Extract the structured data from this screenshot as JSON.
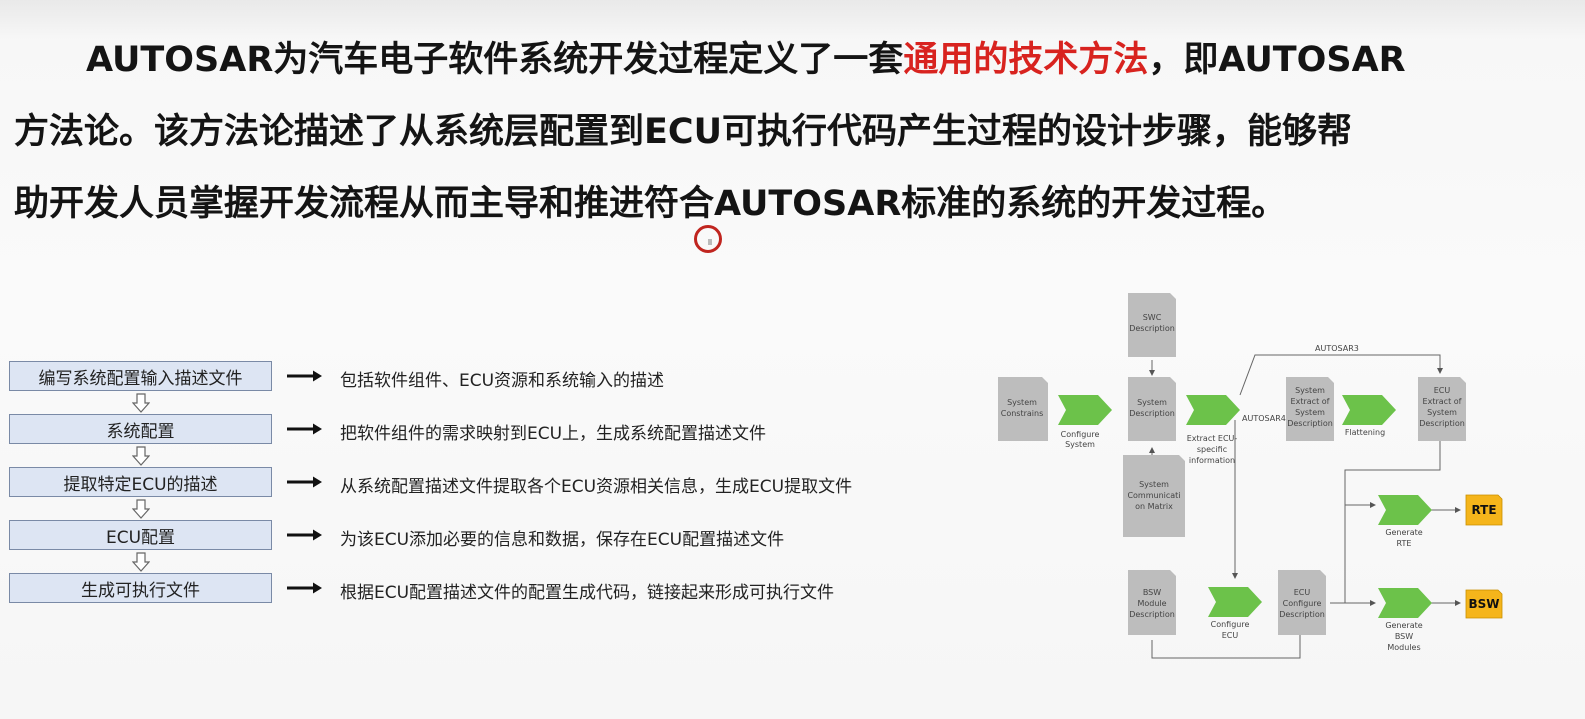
{
  "paragraph": {
    "line1_pre": "AUTOSAR为汽车电子软件系统开发过程定义了一套",
    "line1_highlight": "通用的技术方法",
    "line1_post": "，即AUTOSAR",
    "line2": "方法论。该方法论描述了从系统层配置到ECU可执行代码产生过程的设计步骤，能够帮",
    "line3": "助开发人员掌握开发流程从而主导和推进符合AUTOSAR标准的系统的开发过程。"
  },
  "steps": [
    {
      "label": "编写系统配置输入描述文件",
      "desc": "包括软件组件、ECU资源和系统输入的描述"
    },
    {
      "label": "系统配置",
      "desc": "把软件组件的需求映射到ECU上，生成系统配置描述文件"
    },
    {
      "label": "提取特定ECU的描述",
      "desc": "从系统配置描述文件提取各个ECU资源相关信息，生成ECU提取文件"
    },
    {
      "label": "ECU配置",
      "desc": "为该ECU添加必要的信息和数据，保存在ECU配置描述文件"
    },
    {
      "label": "生成可执行文件",
      "desc": "根据ECU配置描述文件的配置生成代码，链接起来形成可执行文件"
    }
  ],
  "diagram": {
    "swc_desc": [
      "SWC",
      "Description"
    ],
    "system_constraints": [
      "System",
      "Constrains"
    ],
    "configure_system": [
      "Configure",
      "System"
    ],
    "system_desc": [
      "System",
      "Description"
    ],
    "extract_ecu": [
      "Extract ECU-",
      "specific",
      "information"
    ],
    "autosar_label": "AUTOSAR4",
    "autosar3_label": "AUTOSAR3",
    "system_extract": [
      "System",
      "Extract of",
      "System",
      "Description"
    ],
    "flattening": "Flattening",
    "ecu_extract": [
      "ECU",
      "Extract of",
      "System",
      "Description"
    ],
    "comm_matrix": [
      "System",
      "Communicati",
      "on Matrix"
    ],
    "generate_rte": [
      "Generate",
      "RTE"
    ],
    "rte": "RTE",
    "bsw_module_desc": [
      "BSW",
      "Module",
      "Description"
    ],
    "configure_ecu": [
      "Configure",
      "ECU"
    ],
    "ecu_config_desc": [
      "ECU",
      "Configure",
      "Description"
    ],
    "generate_bsw": [
      "Generate",
      "BSW",
      "Modules"
    ],
    "bsw": "BSW"
  },
  "colors": {
    "highlight": "#d8231f",
    "step_fill": "#dde5f3",
    "doc_gray": "#bdbdbd",
    "process_green": "#6cc24a",
    "output_orange": "#f5b51b"
  }
}
